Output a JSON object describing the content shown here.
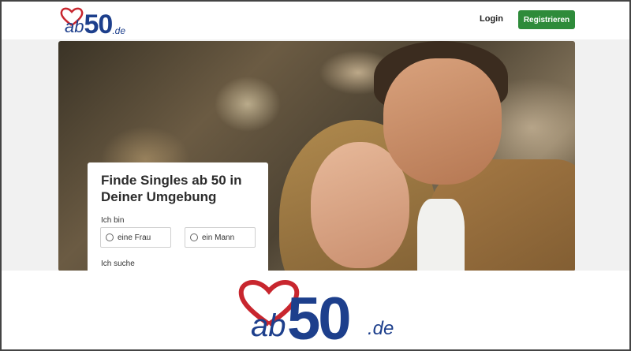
{
  "brand": {
    "ab": "ab",
    "fifty": "50",
    "tld": ".de",
    "heart_color": "#c8262e",
    "text_color": "#1d3f8c"
  },
  "header": {
    "login_label": "Login",
    "register_label": "Registrieren",
    "register_color": "#2e8b3a"
  },
  "search": {
    "title": "Finde Singles ab 50 in Deiner Umgebung",
    "i_am_label": "Ich bin",
    "options": [
      "eine Frau",
      "ein Mann"
    ],
    "looking_for_label": "Ich suche"
  }
}
